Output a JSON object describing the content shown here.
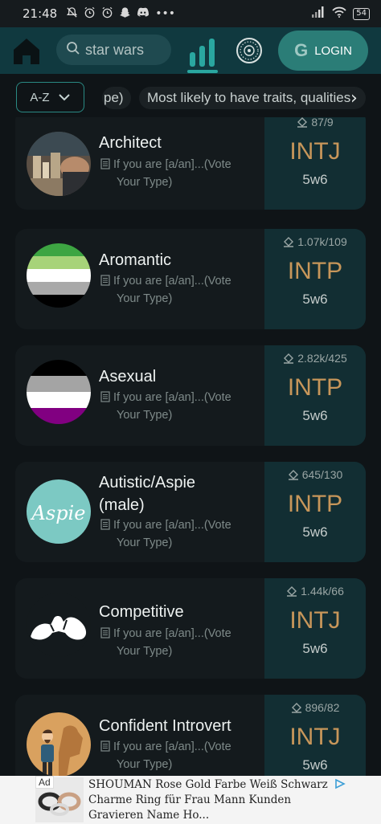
{
  "status_bar": {
    "time": "21:48",
    "battery": "54",
    "icons": [
      "muted-bell-icon",
      "alarm-icon",
      "alarm-icon",
      "snapchat-icon",
      "discord-icon",
      "more-dots-icon",
      "signal-icon",
      "wifi-icon",
      "battery-icon"
    ]
  },
  "nav": {
    "search_placeholder": "star wars",
    "login_label": "LOGIN",
    "google_letter": "G",
    "accent": "#2b7d77"
  },
  "filters": {
    "sort_label": "A-Z",
    "chips": [
      "pe)",
      "Most likely to have traits, qualities"
    ]
  },
  "cards": [
    {
      "title_lines": [
        "Architect"
      ],
      "desc_line1": "If you are [a/an]...(Vote",
      "desc_line2": "Your Type)",
      "votes": "87/9",
      "type": "INTJ",
      "enneagram": "5w6",
      "avatar": "architect-photo"
    },
    {
      "title_lines": [
        "Aromantic"
      ],
      "desc_line1": "If you are [a/an]...(Vote",
      "desc_line2": "Your Type)",
      "votes": "1.07k/109",
      "type": "INTP",
      "enneagram": "5w6",
      "avatar": "aromantic-flag"
    },
    {
      "title_lines": [
        "Asexual"
      ],
      "desc_line1": "If you are [a/an]...(Vote",
      "desc_line2": "Your Type)",
      "votes": "2.82k/425",
      "type": "INTP",
      "enneagram": "5w6",
      "avatar": "asexual-flag"
    },
    {
      "title_lines": [
        "Autistic/Aspie",
        "(male)"
      ],
      "desc_line1": "If you are [a/an]...(Vote",
      "desc_line2": "Your Type)",
      "votes": "645/130",
      "type": "INTP",
      "enneagram": "5w6",
      "avatar": "aspie-logo",
      "avatar_text": "Aspie"
    },
    {
      "title_lines": [
        "Competitive"
      ],
      "desc_line1": "If you are [a/an]...(Vote",
      "desc_line2": "Your Type)",
      "votes": "1.44k/66",
      "type": "INTJ",
      "enneagram": "5w6",
      "avatar": "arm-wrestling-icon"
    },
    {
      "title_lines": [
        "Confident Introvert"
      ],
      "desc_line1": "If you are [a/an]...(Vote",
      "desc_line2": "Your Type)",
      "votes": "896/82",
      "type": "INTJ",
      "enneagram": "5w6",
      "avatar": "confident-introvert-illustration"
    }
  ],
  "ad": {
    "label": "Ad",
    "text": "SHOUMAN Rose Gold Farbe Weiß Schwarz Charme Ring für Frau Mann Kunden Gravieren Name Ho..."
  }
}
